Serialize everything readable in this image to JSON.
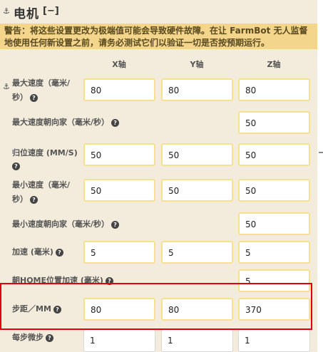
{
  "section": {
    "title": "电机",
    "collapse_label": "[−]"
  },
  "warning": "警告：将这些设置更改为极端值可能会导致硬件故障。在让 FarmBot 无人监督地使用任何新设置之前，请务必测试它们以验证一切是否按预期运行。",
  "columns": [
    "X轴",
    "Y轴",
    "Z轴"
  ],
  "rows": [
    {
      "label_line1": "最大速度（毫米/",
      "label_line2": "秒）",
      "values": [
        "80",
        "80",
        "80"
      ]
    },
    {
      "label": "最大速度朝向家（毫米/秒）",
      "values": [
        "",
        "",
        "50"
      ]
    },
    {
      "label_line1": "归位速度 (MM/S)",
      "values": [
        "50",
        "50",
        "50"
      ]
    },
    {
      "label_line1": "最小速度（毫米/",
      "label_line2": "秒）",
      "values": [
        "50",
        "50",
        "50"
      ]
    },
    {
      "label": "最小速度朝向家（毫米/秒）",
      "values": [
        "",
        "",
        "50"
      ]
    },
    {
      "label": "加速 (毫米)",
      "values": [
        "5",
        "5",
        "5"
      ]
    },
    {
      "label": "朝HOME位置加速 (毫米)",
      "values": [
        "",
        "",
        "5"
      ]
    },
    {
      "label": "步距／MM",
      "values": [
        "80",
        "80",
        "370"
      ]
    },
    {
      "label": "每步微步",
      "values": [
        "1",
        "1",
        "1"
      ]
    }
  ],
  "help_glyph": "?",
  "colors": {
    "background": "#f3ecdc",
    "warning_bg": "#f3d58b",
    "field_border": "#f7e18f",
    "highlight": "#e0000f"
  }
}
